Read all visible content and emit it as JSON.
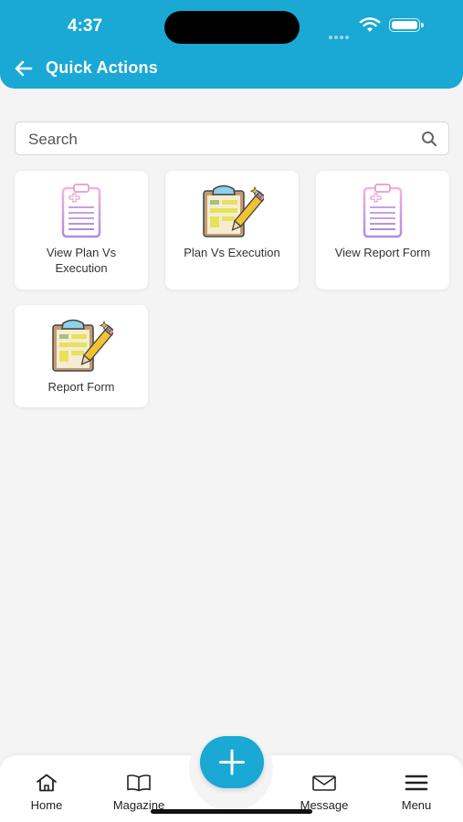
{
  "status_bar": {
    "time": "4:37"
  },
  "header": {
    "title": "Quick Actions"
  },
  "search": {
    "placeholder": "Search"
  },
  "actions": [
    {
      "label": "View Plan Vs Execution",
      "icon": "clipboard-list-icon"
    },
    {
      "label": "Plan Vs Execution",
      "icon": "clipboard-edit-icon"
    },
    {
      "label": "View Report Form",
      "icon": "clipboard-list-icon"
    },
    {
      "label": "Report Form",
      "icon": "clipboard-edit-icon"
    }
  ],
  "tabbar": {
    "home": "Home",
    "magazine": "Magazine",
    "message": "Message",
    "menu": "Menu"
  },
  "colors": {
    "accent": "#1aa8d4",
    "background": "#f4f4f4"
  }
}
